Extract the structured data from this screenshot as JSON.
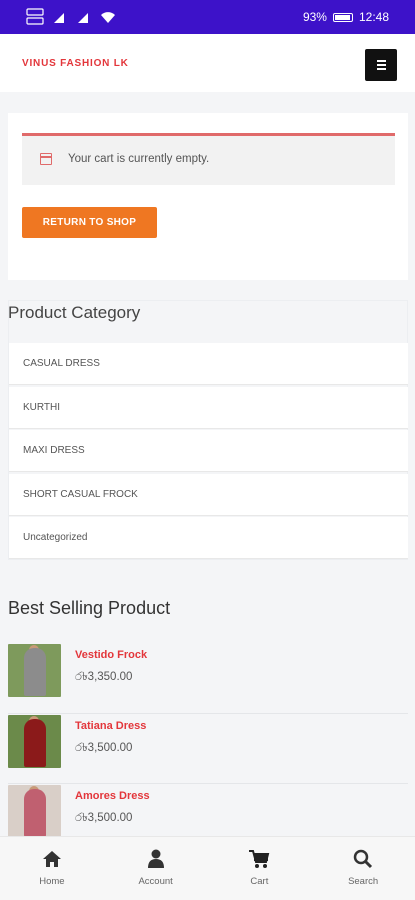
{
  "status_bar": {
    "left": "▣ .… ‥",
    "battery": "93%",
    "time": "12:48"
  },
  "header": {
    "brand": "VINUS FASHION LK",
    "menu_icon": "hamburger-icon"
  },
  "cart": {
    "empty_message": "Your cart is currently empty.",
    "return_button": "RETURN TO SHOP"
  },
  "categories": {
    "title": "Product Category",
    "items": [
      "CASUAL DRESS",
      "KURTHI",
      "MAXI DRESS",
      "SHORT CASUAL FROCK",
      "Uncategorized"
    ]
  },
  "best_selling": {
    "title": "Best Selling Product",
    "products": [
      {
        "name": "Vestido Frock",
        "price": "ර৳3,350.00",
        "thumb_bg": "#7e9a5c",
        "dress_color": "#8c8c8c"
      },
      {
        "name": "Tatiana Dress",
        "price": "ර৳3,500.00",
        "thumb_bg": "#6b8a4a",
        "dress_color": "#8b1a1a"
      },
      {
        "name": "Amores Dress",
        "price": "ර৳3,500.00",
        "thumb_bg": "#d9cfc8",
        "dress_color": "#c06070"
      }
    ]
  },
  "bottom_nav": {
    "items": [
      {
        "label": "Home",
        "icon": "home-icon"
      },
      {
        "label": "Account",
        "icon": "user-icon"
      },
      {
        "label": "Cart",
        "icon": "cart-icon"
      },
      {
        "label": "Search",
        "icon": "search-icon"
      }
    ]
  }
}
